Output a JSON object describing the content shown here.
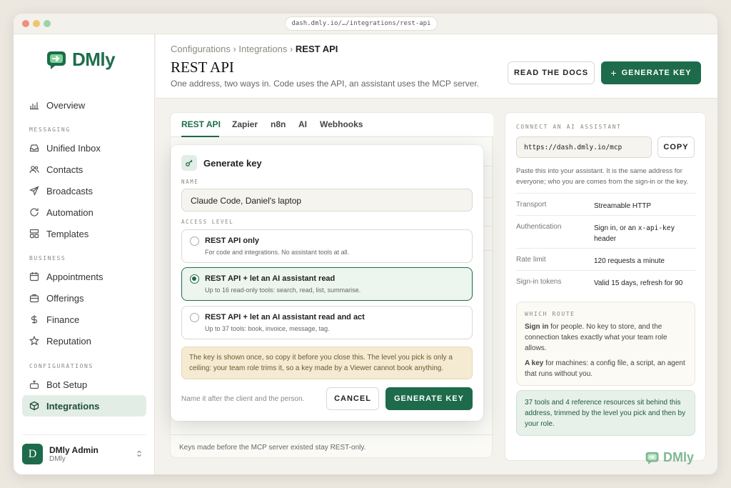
{
  "browser": {
    "url": "dash.dmly.io/…/integrations/rest-api"
  },
  "brand": {
    "name": "DMly",
    "color": "#1d6b4a"
  },
  "sidebar": {
    "overview": "Overview",
    "sections": {
      "messaging": "MESSAGING",
      "business": "BUSINESS",
      "configurations": "CONFIGURATIONS"
    },
    "messaging": [
      "Unified Inbox",
      "Contacts",
      "Broadcasts",
      "Automation",
      "Templates"
    ],
    "business": [
      "Appointments",
      "Offerings",
      "Finance",
      "Reputation"
    ],
    "configurations": [
      "Bot Setup",
      "Integrations"
    ],
    "active": "Integrations",
    "user": {
      "initial": "D",
      "name": "DMly Admin",
      "org": "DMly"
    }
  },
  "header": {
    "breadcrumb": [
      "Configurations",
      "Integrations",
      "REST API"
    ],
    "title": "REST API",
    "subtitle": "One address, two ways in. Code uses the API, an assistant uses the MCP server.",
    "docs_button": "READ THE DOCS",
    "generate_button": "GENERATE KEY",
    "generate_icon": "+"
  },
  "tabs": [
    "REST API",
    "Zapier",
    "n8n",
    "AI",
    "Webhooks"
  ],
  "active_tab": "REST API",
  "legacy_note": "Keys made before the MCP server existed stay REST-only.",
  "modal": {
    "title": "Generate key",
    "name_label": "NAME",
    "name_value": "Claude Code, Daniel's laptop",
    "access_label": "ACCESS LEVEL",
    "options": [
      {
        "title": "REST API only",
        "desc": "For code and integrations. No assistant tools at all.",
        "selected": false
      },
      {
        "title": "REST API + let an AI assistant read",
        "desc": "Up to 16 read-only tools: search, read, list, summarise.",
        "selected": true
      },
      {
        "title": "REST API + let an AI assistant read and act",
        "desc": "Up to 37 tools: book, invoice, message, tag.",
        "selected": false
      }
    ],
    "warning": "The key is shown once, so copy it before you close this. The level you pick is only a ceiling: your team role trims it, so a key made by a Viewer cannot book anything.",
    "hint": "Name it after the client and the person.",
    "cancel": "CANCEL",
    "submit": "GENERATE KEY"
  },
  "assistant": {
    "label": "CONNECT AN AI ASSISTANT",
    "url": "https://dash.dmly.io/mcp",
    "copy": "COPY",
    "desc": "Paste this into your assistant. It is the same address for everyone; who you are comes from the sign-in or the key.",
    "rows": [
      {
        "key": "Transport",
        "value": "Streamable HTTP"
      },
      {
        "key": "Authentication",
        "value_pre": "Sign in, or an ",
        "value_code": "x-api-key",
        "value_post": " header"
      },
      {
        "key": "Rate limit",
        "value": "120 requests a minute"
      },
      {
        "key": "Sign-in tokens",
        "value": "Valid 15 days, refresh for 90"
      }
    ],
    "route_label": "WHICH ROUTE",
    "route_signin_bold": "Sign in",
    "route_signin_rest": " for people. No key to store, and the connection takes exactly what your team role allows.",
    "route_key_bold": "A key",
    "route_key_rest": " for machines: a config file, a script, an agent that runs without you.",
    "stat": "37 tools and 4 reference resources sit behind this address, trimmed by the level you pick and then by your role."
  }
}
